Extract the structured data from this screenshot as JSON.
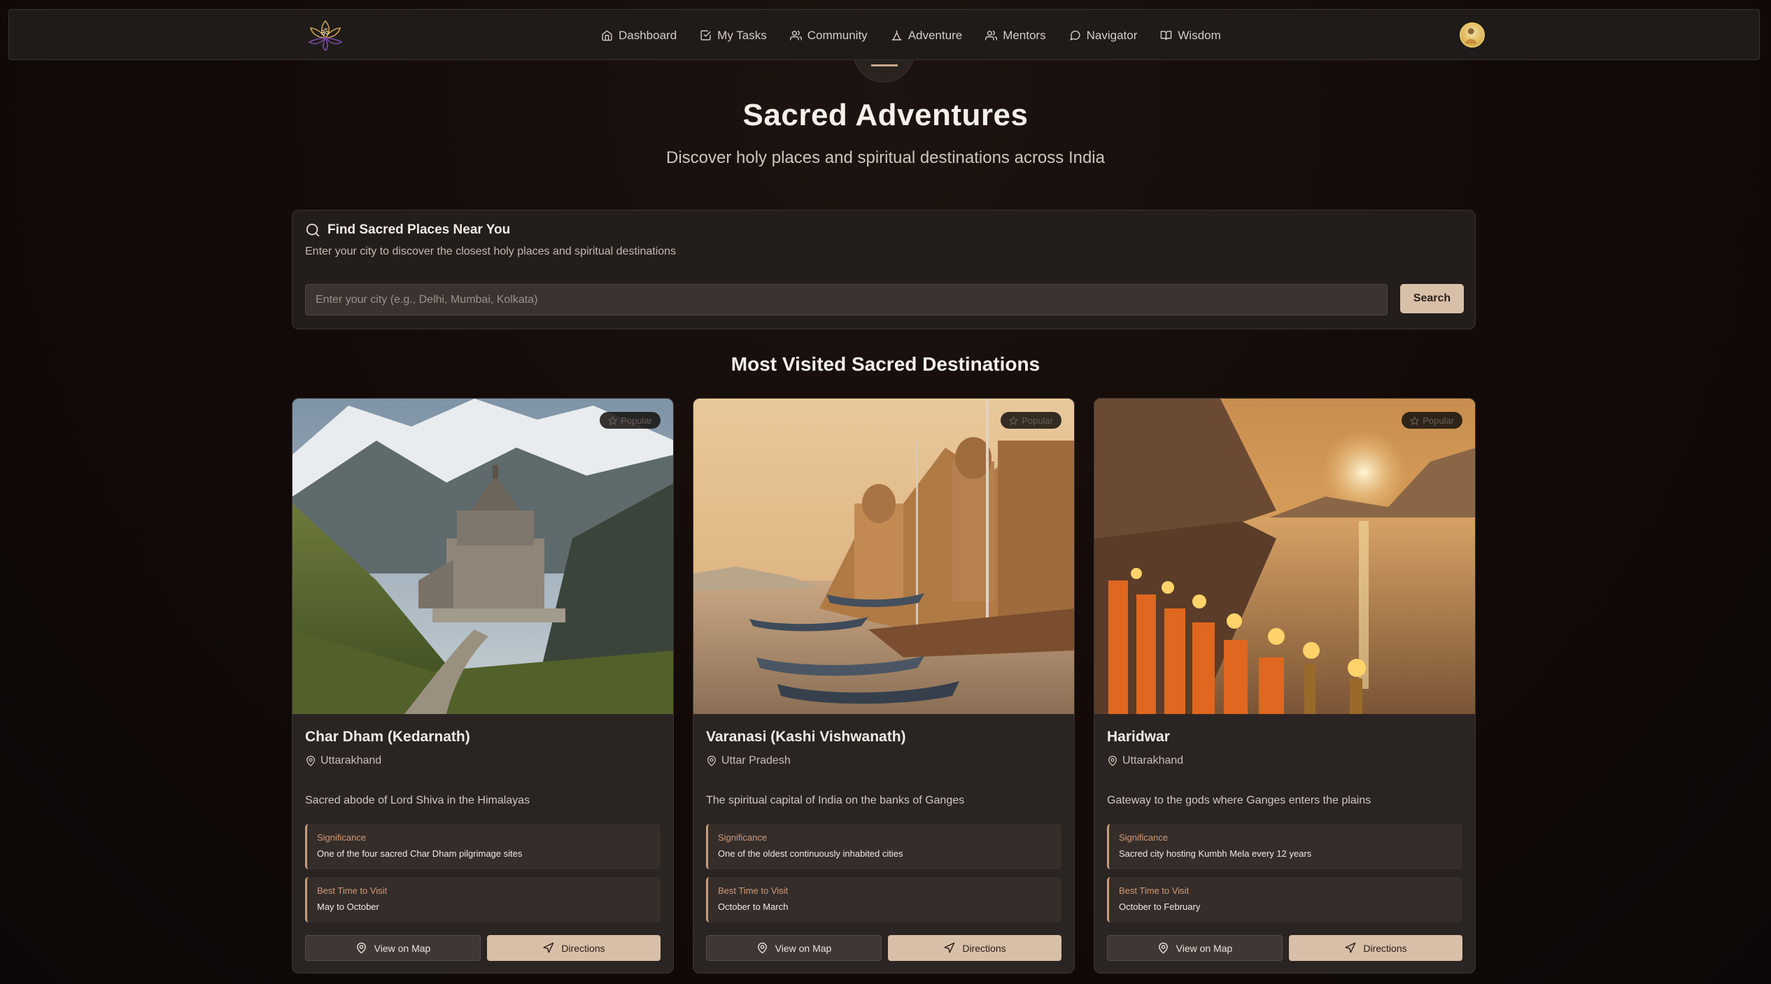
{
  "nav": {
    "items": [
      {
        "label": "Dashboard",
        "icon": "home-icon"
      },
      {
        "label": "My Tasks",
        "icon": "checkbox-icon"
      },
      {
        "label": "Community",
        "icon": "users-icon"
      },
      {
        "label": "Adventure",
        "icon": "mountain-icon"
      },
      {
        "label": "Mentors",
        "icon": "users-icon"
      },
      {
        "label": "Navigator",
        "icon": "chat-bubble-icon"
      },
      {
        "label": "Wisdom",
        "icon": "book-icon"
      }
    ],
    "active": "Adventure"
  },
  "hero": {
    "title": "Sacred Adventures",
    "subtitle": "Discover holy places and spiritual destinations across India"
  },
  "search": {
    "title": "Find Sacred Places Near You",
    "description": "Enter your city to discover the closest holy places and spiritual destinations",
    "placeholder": "Enter your city (e.g., Delhi, Mumbai, Kolkata)",
    "value": "",
    "button": "Search"
  },
  "section": {
    "title": "Most Visited Sacred Destinations"
  },
  "destinations": [
    {
      "badge": "Popular",
      "name": "Char Dham (Kedarnath)",
      "location": "Uttarakhand",
      "description": "Sacred abode of Lord Shiva in the Himalayas",
      "significance_label": "Significance",
      "significance": "One of the four sacred Char Dham pilgrimage sites",
      "best_time_label": "Best Time to Visit",
      "best_time": "May to October",
      "map_button": "View on Map",
      "directions_button": "Directions"
    },
    {
      "badge": "Popular",
      "name": "Varanasi (Kashi Vishwanath)",
      "location": "Uttar Pradesh",
      "description": "The spiritual capital of India on the banks of Ganges",
      "significance_label": "Significance",
      "significance": "One of the oldest continuously inhabited cities",
      "best_time_label": "Best Time to Visit",
      "best_time": "October to March",
      "map_button": "View on Map",
      "directions_button": "Directions"
    },
    {
      "badge": "Popular",
      "name": "Haridwar",
      "location": "Uttarakhand",
      "description": "Gateway to the gods where Ganges enters the plains",
      "significance_label": "Significance",
      "significance": "Sacred city hosting Kumbh Mela every 12 years",
      "best_time_label": "Best Time to Visit",
      "best_time": "October to February",
      "map_button": "View on Map",
      "directions_button": "Directions"
    }
  ],
  "colors": {
    "background": "#120a08",
    "card": "#2a2422",
    "accent": "#d8bfa8",
    "label_accent": "#d19a78"
  }
}
